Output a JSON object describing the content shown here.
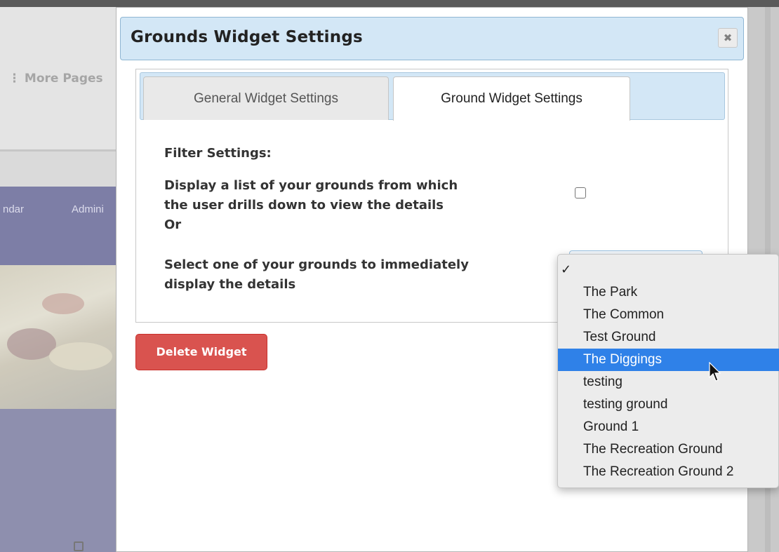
{
  "background": {
    "more_pages_label": "⋮ More Pages",
    "nav_items": [
      "ndar",
      "Admini"
    ]
  },
  "modal": {
    "title": "Grounds Widget Settings",
    "close_symbol": "✖",
    "tabs": [
      {
        "label": "General Widget Settings",
        "active": false
      },
      {
        "label": "Ground Widget Settings",
        "active": true
      }
    ],
    "filter_heading": "Filter Settings:",
    "display_list_label_line1": "Display a list of your grounds from which",
    "display_list_label_line2": "the user drills down to view the details",
    "or_label": "Or",
    "select_one_label_line1": "Select one of your grounds to immediately",
    "select_one_label_line2": "display the details",
    "display_list_checked": false,
    "delete_button_label": "Delete Widget"
  },
  "dropdown": {
    "checkmark": "✓",
    "options": [
      "The Park",
      "The Common",
      "Test Ground",
      "The Diggings",
      "testing",
      "testing ground",
      "Ground 1",
      "The Recreation Ground",
      "The Recreation Ground 2"
    ],
    "highlighted_option": "The Diggings"
  },
  "colors": {
    "titlebar_bg": "#d3e7f6",
    "danger": "#d9534f",
    "highlight": "#2f81e8"
  }
}
